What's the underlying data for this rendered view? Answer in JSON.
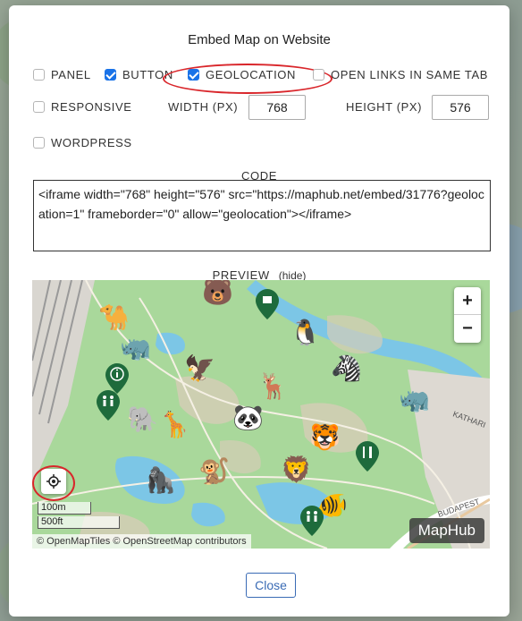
{
  "dialog": {
    "title": "Embed Map on Website"
  },
  "options": {
    "panel": {
      "label": "PANEL",
      "checked": false
    },
    "button": {
      "label": "BUTTON",
      "checked": true
    },
    "geolocation": {
      "label": "GEOLOCATION",
      "checked": true
    },
    "open_links": {
      "label": "OPEN LINKS IN SAME TAB",
      "checked": false
    },
    "responsive": {
      "label": "RESPONSIVE",
      "checked": false
    },
    "wordpress": {
      "label": "WORDPRESS",
      "checked": false
    }
  },
  "size": {
    "width_label": "WIDTH (PX)",
    "width_value": "768",
    "height_label": "HEIGHT (PX)",
    "height_value": "576"
  },
  "code": {
    "label": "CODE",
    "value": "<iframe width=\"768\" height=\"576\" src=\"https://maphub.net/embed/31776?geolocation=1\" frameborder=\"0\" allow=\"geolocation\"></iframe>"
  },
  "preview": {
    "label": "PREVIEW",
    "hide_link": "(hide)",
    "zoom_in": "+",
    "zoom_out": "−",
    "scale_metric": "100m",
    "scale_imperial": "500ft",
    "attribution": "© OpenMapTiles © OpenStreetMap contributors",
    "brand": "MapHub",
    "street_labels": [
      "Katharinenstraße",
      "Budapester"
    ],
    "animals": [
      "camel",
      "bear",
      "penguin",
      "rhino",
      "eagle",
      "zebra",
      "deer",
      "panda",
      "elephant",
      "giraffe",
      "tiger",
      "gorilla",
      "monkey",
      "lion",
      "fish",
      "rhino"
    ]
  },
  "footer": {
    "close_label": "Close"
  },
  "accent_color": "#1a73e8",
  "annotation_color": "#d9262b"
}
